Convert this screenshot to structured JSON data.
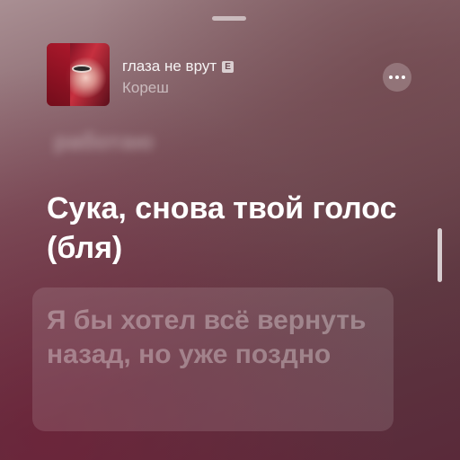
{
  "track": {
    "title": "глаза не врут",
    "explicit_badge": "E",
    "artist": "Кореш"
  },
  "lyrics": {
    "previous_line": "работаю",
    "current_line": "Сука, снова твой голос (бля)",
    "next_line": "Я бы хотел всё вернуть назад, но уже поздно"
  },
  "icons": {
    "more": "more-icon",
    "artwork": "album-artwork"
  }
}
